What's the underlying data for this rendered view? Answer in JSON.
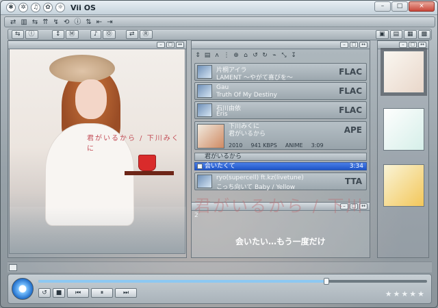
{
  "app": {
    "title": "Vii OS",
    "title_icons": [
      "✱",
      "✲",
      "♫",
      "✿",
      "☼"
    ],
    "window_controls": [
      "–",
      "□",
      "×"
    ]
  },
  "menu": {
    "items": [
      "⇄",
      "▥",
      "⇆",
      "⇈",
      "↯",
      "⟲",
      "ⓘ",
      "⇅",
      "⇤",
      "⇥"
    ],
    "right_icons": [
      "▣",
      "▤",
      "▦",
      "▩"
    ]
  },
  "toolbar": {
    "groups": [
      [
        "⇆",
        "ⓛ"
      ],
      [
        "↕",
        "Ⓜ"
      ],
      [
        "♪",
        "Ⓞ"
      ],
      [
        "⇄",
        "Ⓡ"
      ]
    ]
  },
  "nowplaying": {
    "album_title": "君がいるから / 下川みくに",
    "artist": "下川みくに",
    "song": "君がいるから",
    "year": "2010",
    "bitrate": "941 KBPS",
    "genre": "ANIME",
    "duration": "3:09",
    "big_title": "君がいるから / 下川",
    "lyric": "会いたい…もう一度だけ",
    "lyric_index": "2"
  },
  "playlist": {
    "tracks": [
      {
        "title": "片桐アイラ",
        "subtitle": "LAMENT ～やがて喜びを～",
        "format": "FLAC"
      },
      {
        "title": "Gau",
        "subtitle": "Truth Of My Destiny",
        "format": "FLAC"
      },
      {
        "title": "石川由依",
        "subtitle": "Eris",
        "format": "FLAC"
      },
      {
        "title": "下川みくに",
        "subtitle": "君がいるから",
        "format": "APE"
      }
    ],
    "queue": [
      {
        "label": "君がいるから",
        "state": "normal"
      },
      {
        "label": "会いたくて",
        "state": "active",
        "time": "3:34"
      },
      {
        "label": "ryo(supercell) ft.kz(livetune)",
        "subtitle": "こっち向いて Baby / Yellow",
        "format": "TTA"
      }
    ],
    "toolbar_icons": [
      "⇕",
      "▤",
      "ʌ",
      "⋮",
      "⊕",
      "⌂",
      "↺",
      "↻",
      "⌁",
      "⤡",
      "↧"
    ]
  },
  "sidebar": {
    "albums": [
      "mini1",
      "mini2",
      "mini3"
    ]
  },
  "controls": {
    "progress": 0.742,
    "volume": 0.92,
    "buttons": [
      "↺",
      "■",
      "⏮",
      "⏸",
      "⏭"
    ],
    "rating_stars": "★★★★★"
  }
}
